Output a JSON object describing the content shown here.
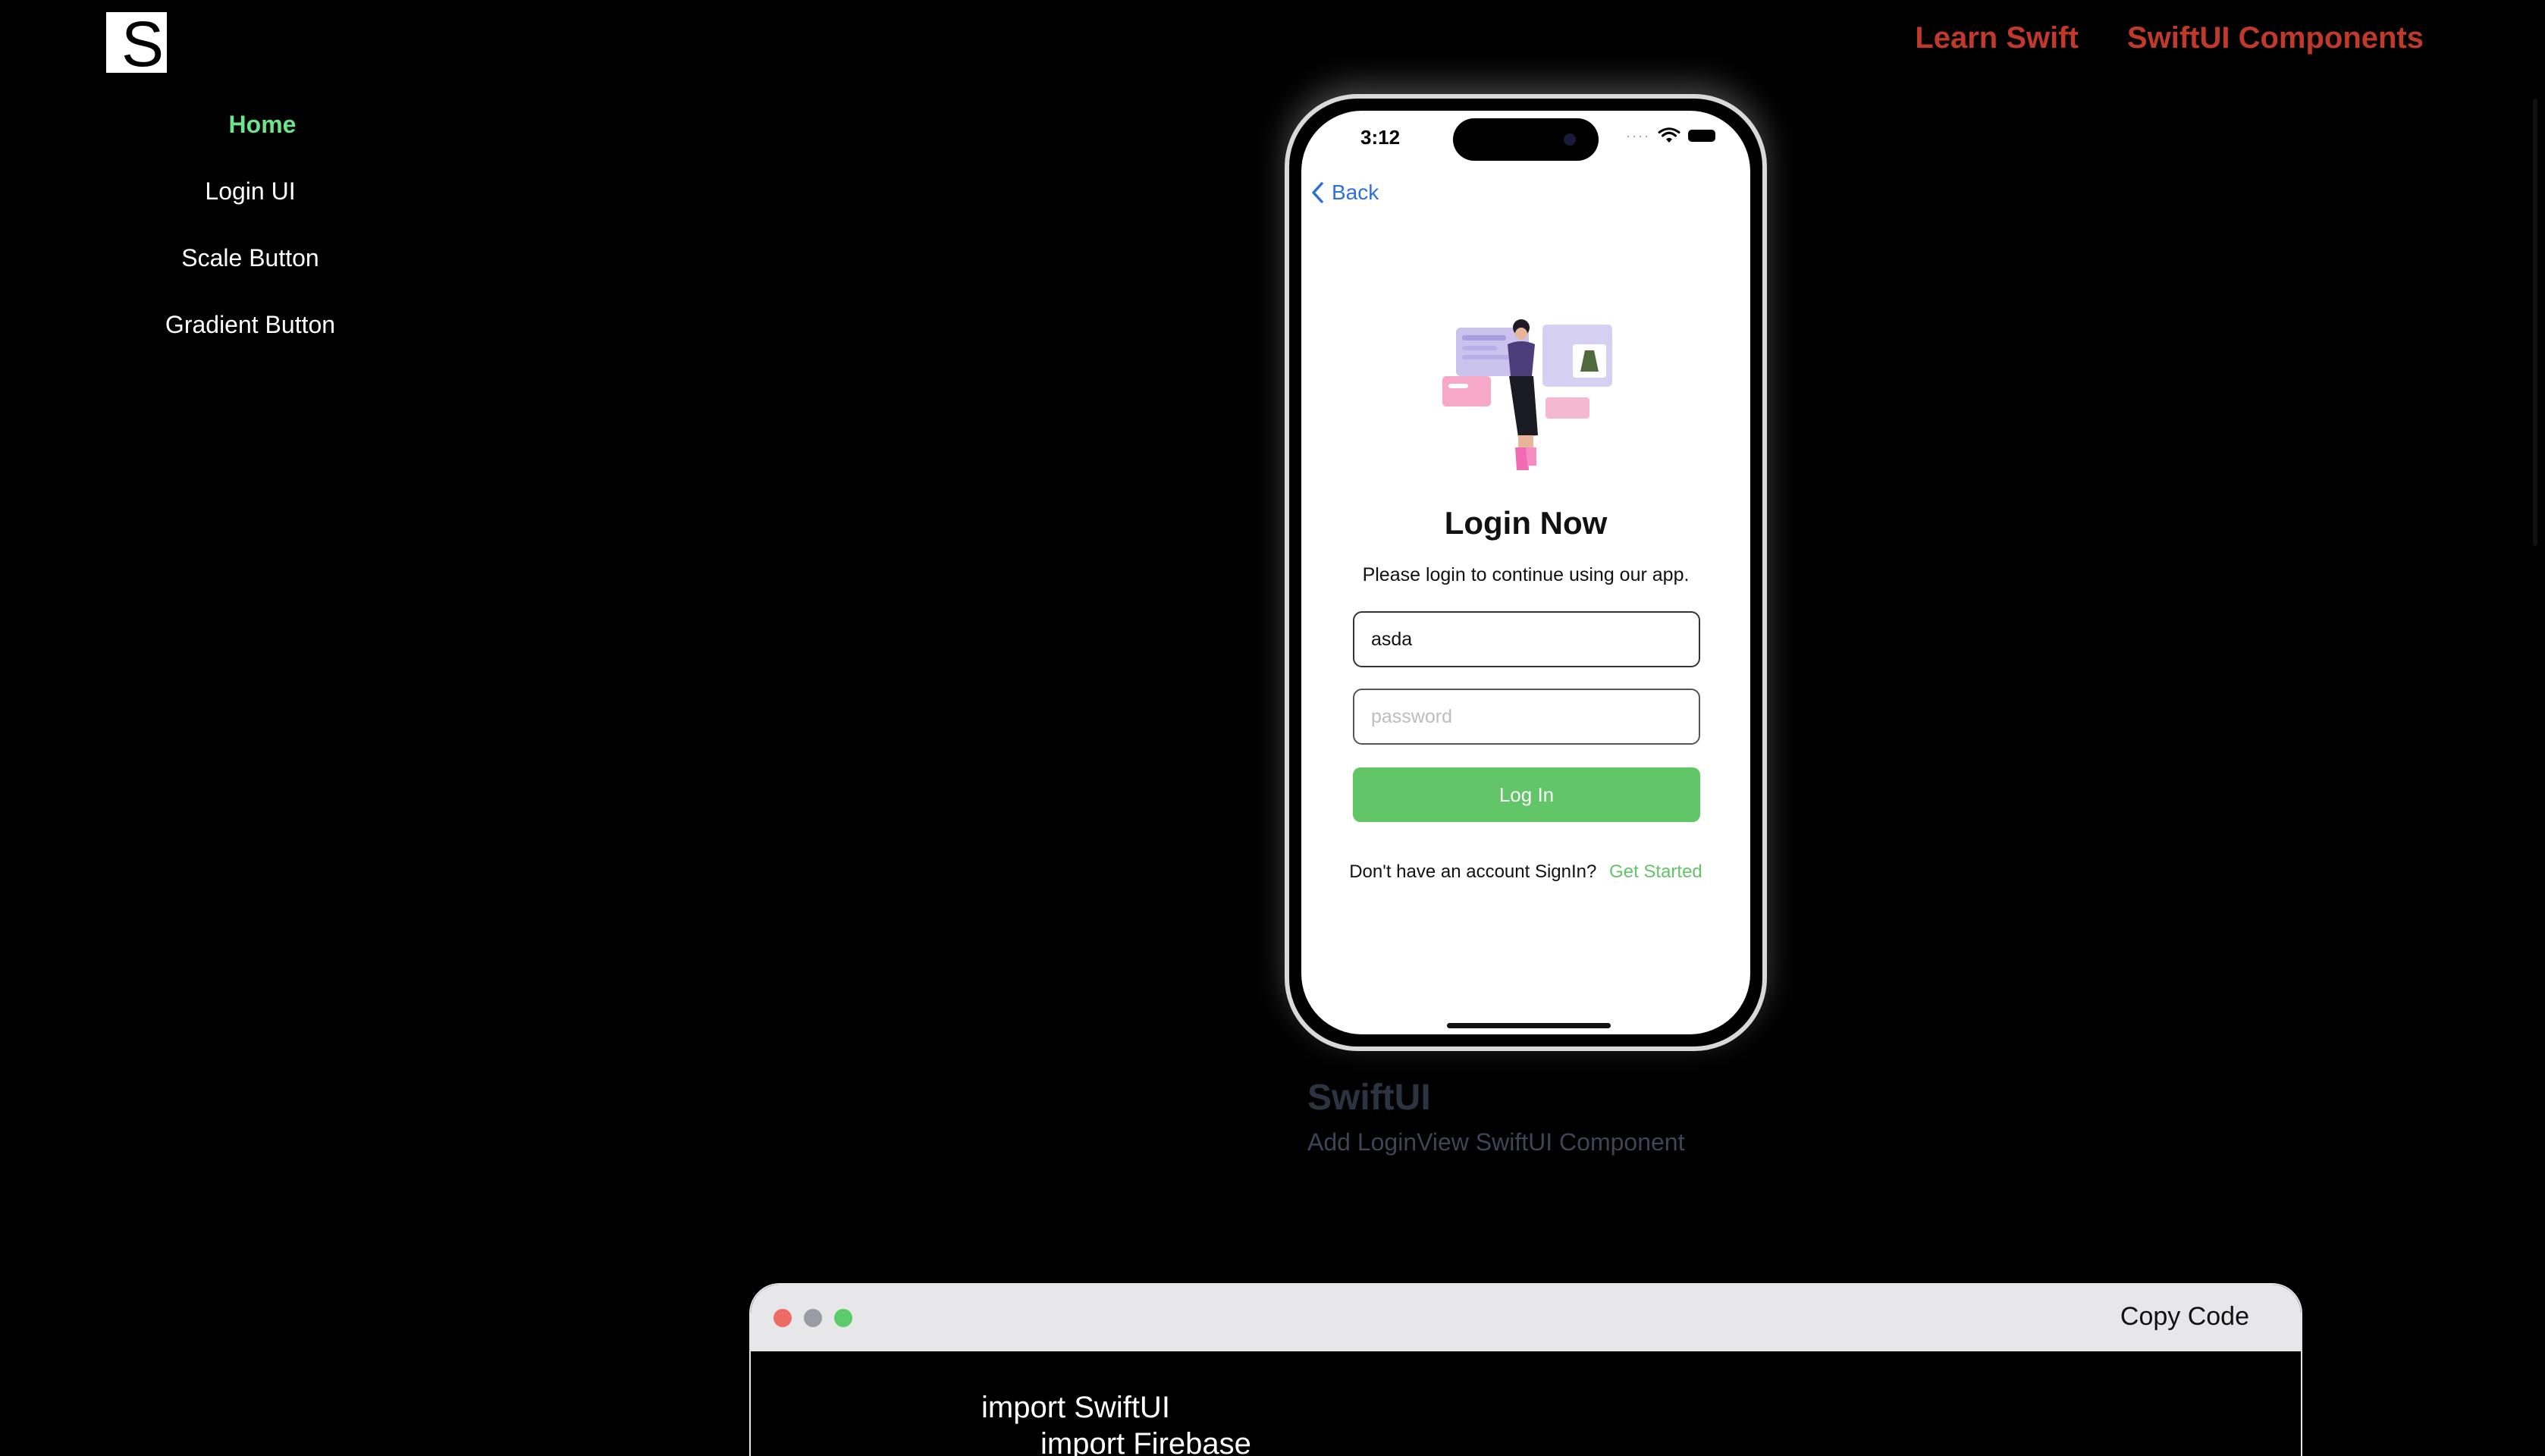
{
  "logo": {
    "letter": "S"
  },
  "topnav": {
    "learn_swift": "Learn Swift",
    "swiftui_components": "SwiftUI Components"
  },
  "sidebar": {
    "items": [
      {
        "label": "Home",
        "active": true
      },
      {
        "label": "Login UI"
      },
      {
        "label": "Scale Button"
      },
      {
        "label": "Gradient Button"
      }
    ]
  },
  "phone": {
    "status_time": "3:12",
    "back_label": "Back",
    "title": "Login Now",
    "subtitle": "Please login to continue using our app.",
    "username_value": "asda",
    "password_placeholder": "password",
    "login_button": "Log In",
    "signup_prompt": "Don't have an  account SignIn?",
    "signup_link": "Get Started"
  },
  "caption": {
    "title": "SwiftUI",
    "subtitle": "Add LoginView SwiftUI Component"
  },
  "code_window": {
    "copy_label": "Copy Code",
    "lines": [
      "import SwiftUI",
      "import Firebase"
    ]
  },
  "colors": {
    "accent_green": "#62c567",
    "nav_red": "#c0392b",
    "sidebar_active": "#6fe389",
    "link_blue": "#2f6fda"
  }
}
